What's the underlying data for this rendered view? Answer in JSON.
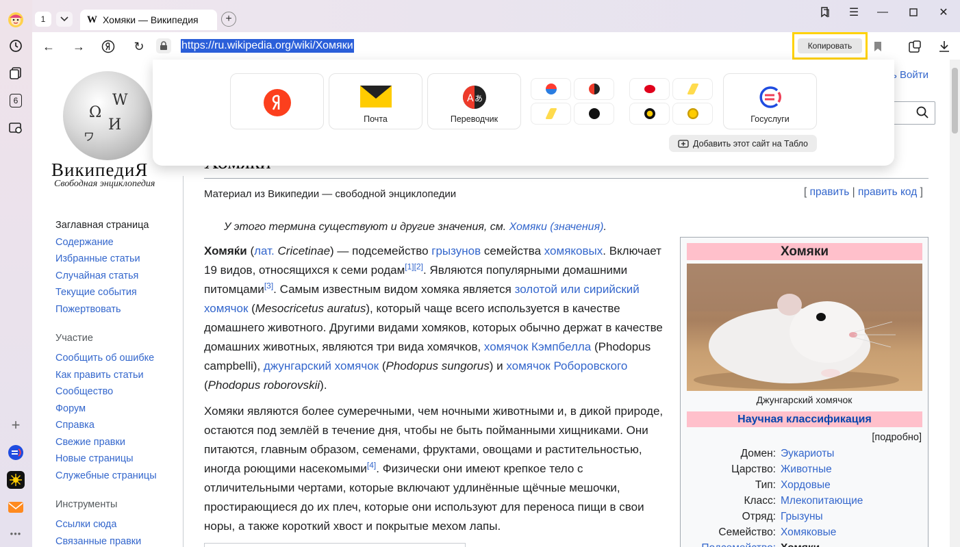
{
  "browser": {
    "tab_count": "1",
    "tab_title": "Хомяки — Википедия",
    "tab_favicon": "W",
    "sidebar_badge": "6",
    "url": "https://ru.wikipedia.org/wiki/Хомяки",
    "copy_label": "Копировать",
    "colors": {
      "selection": "#2b5fd9",
      "highlight_border": "#ffd200"
    }
  },
  "tablo": {
    "tiles": [
      {
        "label": "",
        "icon": "yandex-icon"
      },
      {
        "label": "Почта",
        "icon": "mail-envelope-icon"
      },
      {
        "label": "Переводчик",
        "icon": "translator-icon"
      },
      {
        "label": "",
        "icon": "site-group-1-icon"
      },
      {
        "label": "",
        "icon": "site-group-2-icon"
      },
      {
        "label": "Госуслуги",
        "icon": "gosuslugi-icon"
      }
    ],
    "add_label": "Добавить этот сайт на Табло"
  },
  "wiki": {
    "logo_word": "ВикипедиЯ",
    "logo_tagline": "Свободная энциклопедия",
    "login": "ь  Войти",
    "nav_main": [
      "Заглавная страница",
      "Содержание",
      "Избранные статьи",
      "Случайная статья",
      "Текущие события",
      "Пожертвовать"
    ],
    "participation_heading": "Участие",
    "nav_participation": [
      "Сообщить об ошибке",
      "Как править статьи",
      "Сообщество",
      "Форум",
      "Справка",
      "Свежие правки",
      "Новые страницы",
      "Служебные страницы"
    ],
    "tools_heading": "Инструменты",
    "nav_tools": [
      "Ссылки сюда",
      "Связанные правки"
    ],
    "title": "Хомяки",
    "subtitle": "Материал из Википедии — свободной энциклопедии",
    "edit_links": {
      "open": "[ ",
      "edit": "править",
      "sep": " | ",
      "edit_code": "править код",
      "close": " ]"
    },
    "hatnote_text": "У этого термина существуют и другие значения, см. ",
    "hatnote_link": "Хомяки (значения)",
    "hatnote_end": "."
  },
  "infobox": {
    "title": "Хомяки",
    "caption": "Джунгарский хомячок",
    "section": "Научная классификация",
    "more": "[подробно]",
    "rows": [
      {
        "k": "Домен:",
        "v": "Эукариоты"
      },
      {
        "k": "Царство:",
        "v": "Животные"
      },
      {
        "k": "Тип:",
        "v": "Хордовые"
      },
      {
        "k": "Класс:",
        "v": "Млекопитающие"
      },
      {
        "k": "Отряд:",
        "v": "Грызуны"
      },
      {
        "k": "Семейство:",
        "v": "Хомяковые"
      }
    ],
    "last_row_k": "Подсемейство:",
    "last_row_v": "Хомяки"
  }
}
